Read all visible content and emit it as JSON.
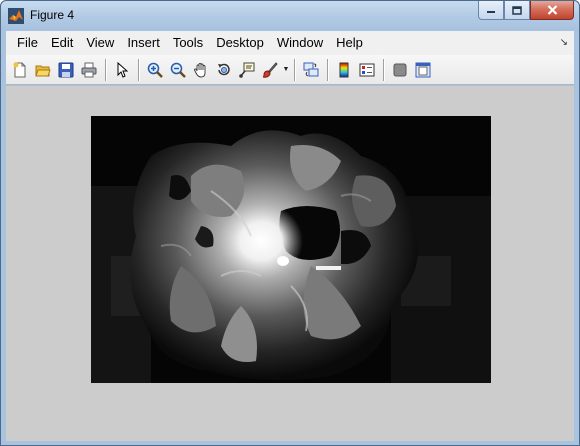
{
  "window": {
    "title": "Figure 4",
    "icon": "matlab-icon"
  },
  "caption_buttons": [
    "minimize-icon",
    "maximize-icon",
    "close-icon"
  ],
  "menubar": {
    "items": [
      "File",
      "Edit",
      "View",
      "Insert",
      "Tools",
      "Desktop",
      "Window",
      "Help"
    ],
    "dock_arrow": "↘"
  },
  "toolbar": {
    "buttons": [
      "new-figure-icon",
      "open-file-icon",
      "save-figure-icon",
      "print-figure-icon",
      "edit-plot-icon",
      "zoom-in-icon",
      "zoom-out-icon",
      "pan-icon",
      "rotate-3d-icon",
      "data-cursor-icon",
      "brush-icon",
      "link-plot-icon",
      "insert-colorbar-icon",
      "insert-legend-icon",
      "hide-plot-tools-icon",
      "show-plot-tools-icon"
    ]
  },
  "figure": {
    "background": "#cccccc",
    "image": {
      "description_color_map": "gray",
      "background": "#000000"
    }
  }
}
